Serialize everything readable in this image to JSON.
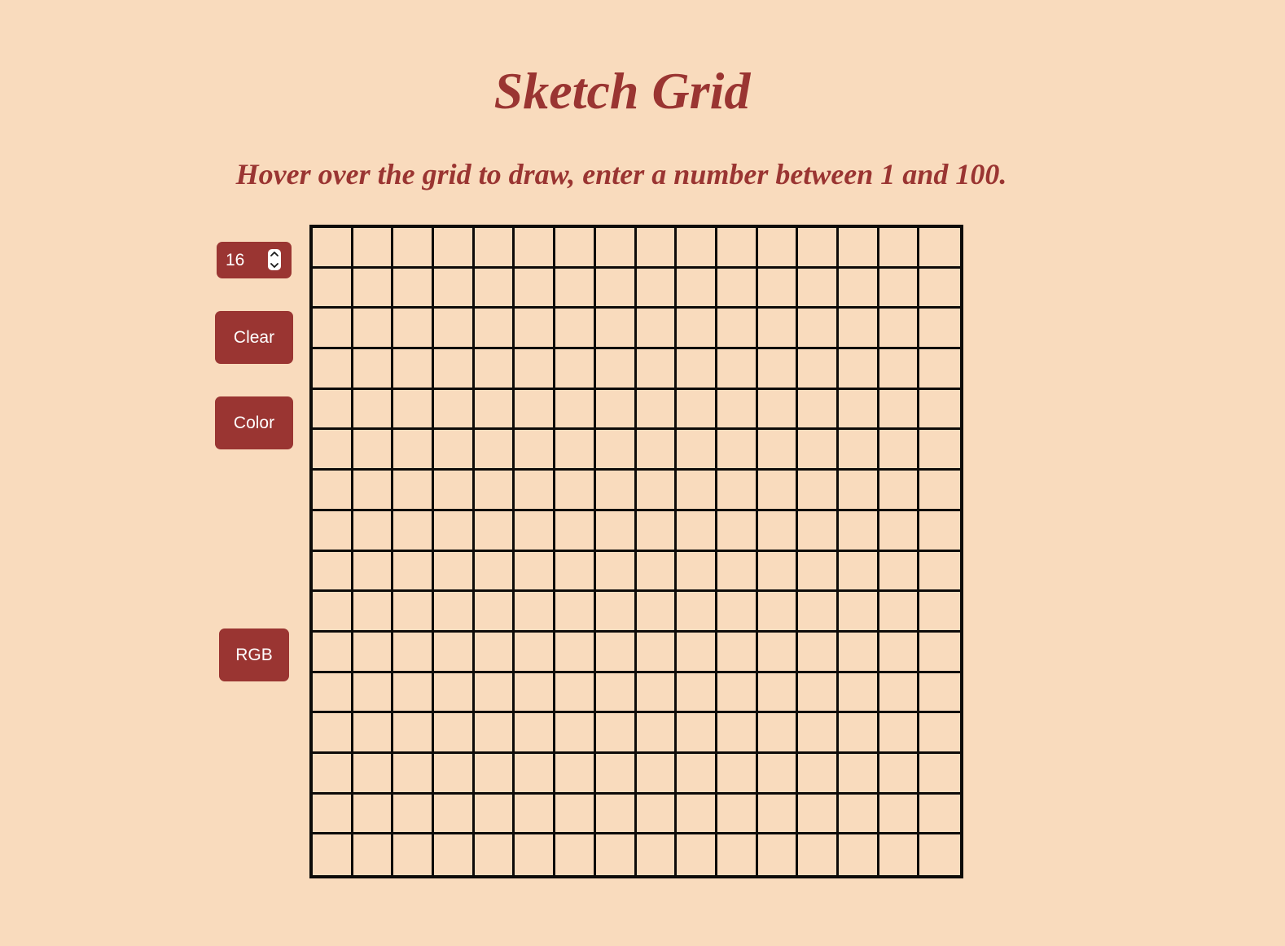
{
  "page": {
    "title": "Sketch Grid",
    "instructions": "Hover over the grid to draw, enter a number between 1 and 100."
  },
  "controls": {
    "grid_size_value": "16",
    "clear_label": "Clear",
    "color_label": "Color",
    "rgb_label": "RGB"
  },
  "grid": {
    "size": 16
  },
  "colors": {
    "background": "#f9dbbd",
    "accent": "#9a3532",
    "grid_line": "#0d0b09",
    "button_text": "#ffffff"
  },
  "icons": {
    "stepper": "stepper-arrows-icon"
  }
}
